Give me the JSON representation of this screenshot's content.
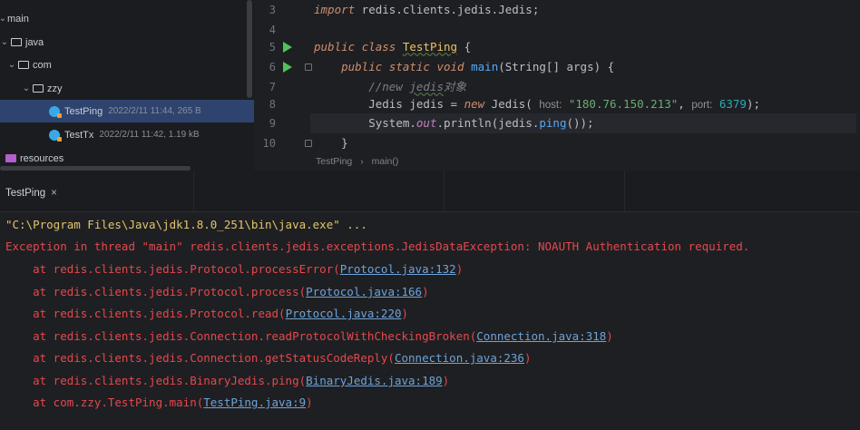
{
  "project_tree": {
    "items": [
      {
        "label": "main",
        "meta": ""
      },
      {
        "label": "java",
        "meta": ""
      },
      {
        "label": "com",
        "meta": ""
      },
      {
        "label": "zzy",
        "meta": ""
      },
      {
        "label": "TestPing",
        "meta": "2022/2/11 11:44, 265 B"
      },
      {
        "label": "TestTx",
        "meta": "2022/2/11 11:42, 1.19 kB"
      },
      {
        "label": "resources",
        "meta": ""
      }
    ]
  },
  "editor": {
    "line_numbers": [
      "3",
      "4",
      "5",
      "6",
      "7",
      "8",
      "9",
      "10"
    ],
    "lines": {
      "l3_import": "import",
      "l3_rest": " redis.clients.jedis.Jedis;",
      "l5_public": "public",
      "l5_class": "class",
      "l5_name": "TestPing",
      "l5_brace": " {",
      "l6_public": "public",
      "l6_static": "static",
      "l6_void": "void",
      "l6_main": "main",
      "l6_rest": "(String[] args) {",
      "l7_comment_a": "//new ",
      "l7_comment_b": "jedis",
      "l7_comment_c": "对象",
      "l8_type": "Jedis jedis = ",
      "l8_new": "new",
      "l8_ctor": " Jedis( ",
      "l8_host_hint": "host:",
      "l8_host": " \"180.76.150.213\"",
      "l8_comma": ", ",
      "l8_port_hint": "port:",
      "l8_port": " 6379",
      "l8_end": ");",
      "l9_system": "System.",
      "l9_out": "out",
      "l9_println": ".println(jedis.",
      "l9_ping": "ping",
      "l9_end": "());",
      "l10_brace": "}"
    },
    "breadcrumb": [
      "TestPing",
      "main()"
    ],
    "breadcrumb_sep": "›"
  },
  "run_window": {
    "tab_label": "TestPing",
    "close_glyph": "×",
    "console": {
      "command": "\"C:\\Program Files\\Java\\jdk1.8.0_251\\bin\\java.exe\" ...",
      "exception": "Exception in thread \"main\" redis.clients.jedis.exceptions.JedisDataException: NOAUTH Authentication required.",
      "stack": [
        {
          "prefix": "    at redis.clients.jedis.Protocol.processError(",
          "link": "Protocol.java:132",
          "suffix": ")"
        },
        {
          "prefix": "    at redis.clients.jedis.Protocol.process(",
          "link": "Protocol.java:166",
          "suffix": ")"
        },
        {
          "prefix": "    at redis.clients.jedis.Protocol.read(",
          "link": "Protocol.java:220",
          "suffix": ")"
        },
        {
          "prefix": "    at redis.clients.jedis.Connection.readProtocolWithCheckingBroken(",
          "link": "Connection.java:318",
          "suffix": ")"
        },
        {
          "prefix": "    at redis.clients.jedis.Connection.getStatusCodeReply(",
          "link": "Connection.java:236",
          "suffix": ")"
        },
        {
          "prefix": "    at redis.clients.jedis.BinaryJedis.ping(",
          "link": "BinaryJedis.java:189",
          "suffix": ")"
        },
        {
          "prefix": "    at com.zzy.TestPing.main(",
          "link": "TestPing.java:9",
          "suffix": ")"
        }
      ]
    }
  },
  "colors": {
    "keyword": "#cf8e6d",
    "class_name": "#e8c46a",
    "string": "#6aab73",
    "number": "#2aacb8",
    "error": "#e5484d",
    "link": "#6ea3d9",
    "run_icon": "#4fc35a",
    "selection": "#2e436e"
  }
}
